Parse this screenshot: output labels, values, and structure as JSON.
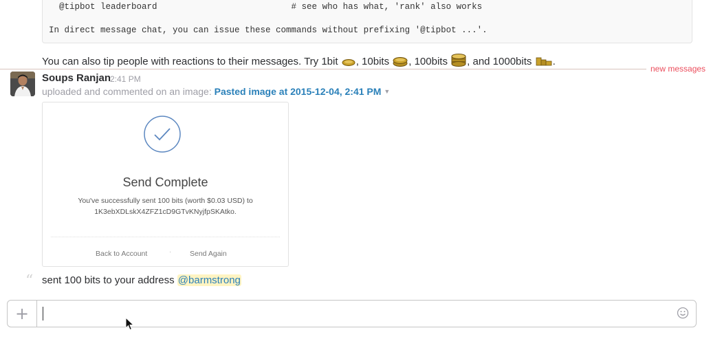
{
  "code_block": {
    "line1": "  @tipbot leaderboard                          # see who has what, 'rank' also works",
    "line2": "In direct message chat, you can issue these commands without prefixing '@tipbot ...'."
  },
  "tip_message": {
    "prefix": "You can also tip people with reactions to their messages. Try 1bit",
    "sep1": ", 10bits",
    "sep2": ", 100bits",
    "sep3": ", and 1000bits",
    "end": "."
  },
  "divider": {
    "label": "new messages"
  },
  "message": {
    "author": "Soups Ranjan",
    "time": "2:41 PM",
    "upload_text": "uploaded and commented on an image: ",
    "file_name": "Pasted image at 2015-12-04, 2:41 PM"
  },
  "image": {
    "title": "Send Complete",
    "desc_line1": "You've successfully sent 100 bits (worth $0.03 USD) to",
    "desc_line2": "1K3ebXDLskX4ZFZ1cD9GTvKNyjfpSKAtko.",
    "back_link": "Back to Account",
    "dot": "·",
    "again_link": "Send Again"
  },
  "bot_message": {
    "text": "sent 100 bits to your address ",
    "mention": "@barmstrong"
  },
  "composer": {
    "plus": "+",
    "value": "",
    "placeholder": ""
  },
  "icons": {
    "coin": "coin-icon",
    "check": "check-circle-icon",
    "quote": "quote-icon",
    "emoji": "emoji-icon"
  },
  "colors": {
    "link": "#2a80b9",
    "new_messages": "#eb4d5c",
    "mention_bg": "#fff4c2"
  }
}
